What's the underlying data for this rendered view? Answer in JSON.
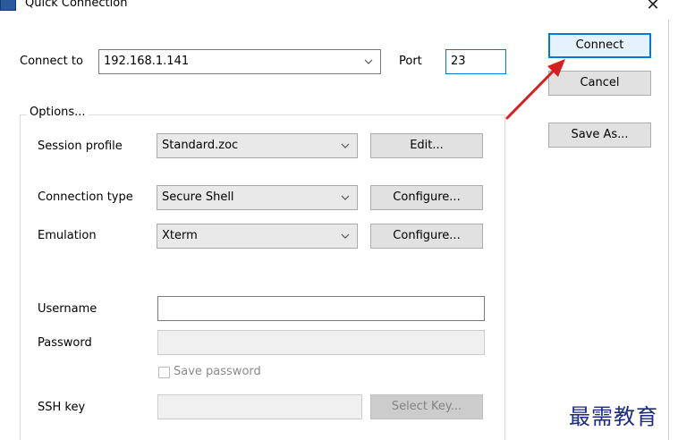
{
  "window": {
    "title": "Quick Connection",
    "close_glyph": "✕"
  },
  "connect_to": {
    "label": "Connect to",
    "value": "192.168.1.141"
  },
  "port": {
    "label": "Port",
    "value": "23"
  },
  "buttons": {
    "connect": "Connect",
    "cancel": "Cancel",
    "save_as": "Save As..."
  },
  "options": {
    "label": "Options...",
    "session_profile": {
      "label": "Session profile",
      "value": "Standard.zoc",
      "button": "Edit..."
    },
    "connection_type": {
      "label": "Connection type",
      "value": "Secure Shell",
      "button": "Configure..."
    },
    "emulation": {
      "label": "Emulation",
      "value": "Xterm",
      "button": "Configure..."
    },
    "username": {
      "label": "Username",
      "value": ""
    },
    "password": {
      "label": "Password",
      "value": ""
    },
    "save_password": {
      "label": "Save password",
      "checked": false
    },
    "ssh_key": {
      "label": "SSH key",
      "value": "",
      "button": "Select Key..."
    }
  },
  "watermark": "最需教育",
  "colors": {
    "accent": "#0078d7",
    "arrow": "#d42020",
    "watermark": "#1c2a8c"
  }
}
